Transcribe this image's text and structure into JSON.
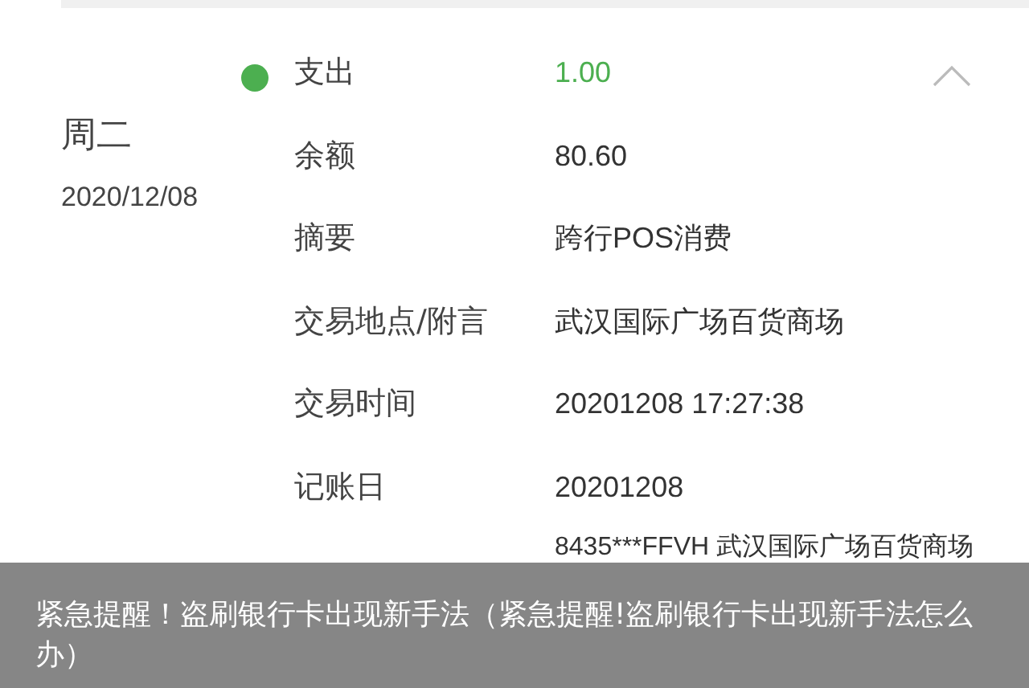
{
  "day": {
    "weekday": "周二",
    "date": "2020/12/08"
  },
  "transaction": {
    "expanded": true,
    "color": "#4caf50",
    "rows": [
      {
        "label": "支出",
        "value": "1.00",
        "kind": "amount"
      },
      {
        "label": "余额",
        "value": "80.60",
        "kind": "plain"
      },
      {
        "label": "摘要",
        "value": "跨行POS消费",
        "kind": "plain"
      },
      {
        "label": "交易地点/附言",
        "value": "武汉国际广场百货商场",
        "kind": "plain"
      },
      {
        "label": "交易时间",
        "value": "20201208 17:27:38",
        "kind": "plain"
      },
      {
        "label": "记账日",
        "value": "20201208",
        "kind": "plain"
      },
      {
        "value": "8435***FFVH 武汉国际广场百货商场",
        "kind": "plain"
      }
    ]
  },
  "caption": "紧急提醒！盗刷银行卡出现新手法（紧急提醒!盗刷银行卡出现新手法怎么办）"
}
